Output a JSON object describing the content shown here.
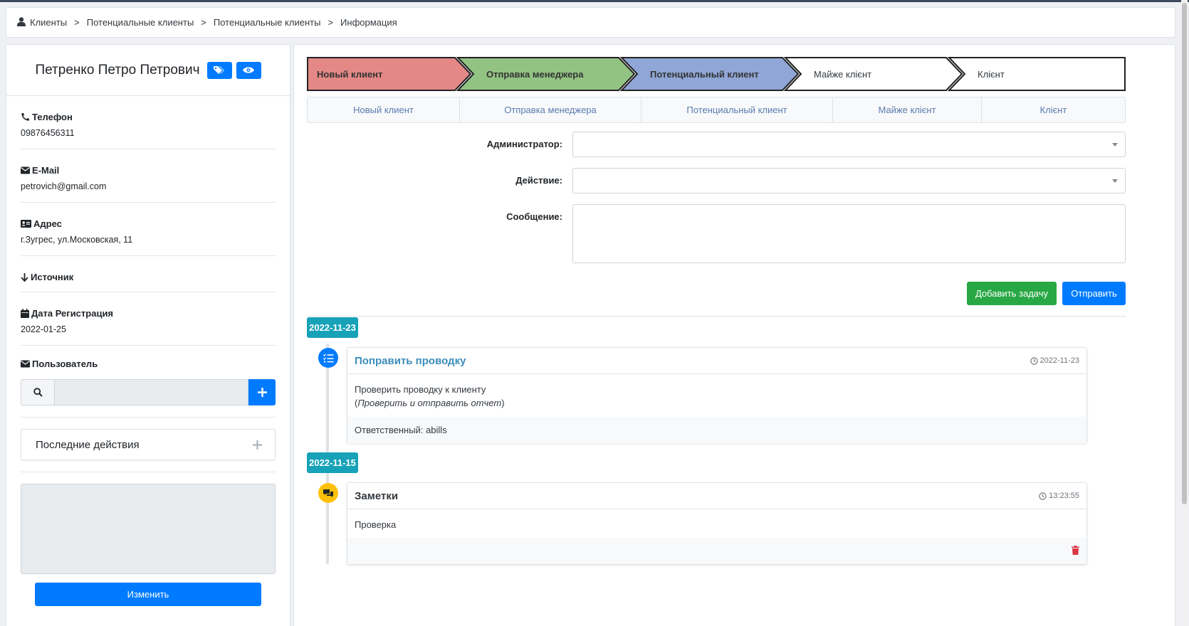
{
  "breadcrumb": [
    "Клиенты",
    "Потенциальные клиенты",
    "Потенциальные клиенты",
    "Информация"
  ],
  "breadcrumb_sep": ">",
  "client": {
    "name": "Петренко Петро Петрович",
    "phone_label": "Телефон",
    "phone": "09876456311",
    "email_label": "E-Mail",
    "email": "petrovich@gmail.com",
    "address_label": "Адрес",
    "address": "г.Зугрес, ул.Московская, 11",
    "source_label": "Источник",
    "regdate_label": "Дата Регистрация",
    "regdate": "2022-01-25",
    "user_label": "Пользователь"
  },
  "recent_actions": "Последние действия",
  "edit_button": "Изменить",
  "pipeline": [
    {
      "label": "Новый клиент",
      "color": "#e48886",
      "bold": true
    },
    {
      "label": "Отправка менеджера",
      "color": "#92c383",
      "bold": true
    },
    {
      "label": "Потенциальный клиент",
      "color": "#8fa6d6",
      "bold": true
    },
    {
      "label": "Майже клієнт",
      "color": "#ffffff",
      "bold": false
    },
    {
      "label": "Клієнт",
      "color": "#ffffff",
      "bold": false
    }
  ],
  "tabs": [
    "Новый клиент",
    "Отправка менеджера",
    "Потенциальный клиент",
    "Майже клієнт",
    "Клієнт"
  ],
  "form": {
    "admin_label": "Администратор:",
    "action_label": "Действие:",
    "message_label": "Сообщение:",
    "add_task": "Добавить задачу",
    "send": "Отправить"
  },
  "timeline": [
    {
      "date": "2022-11-23",
      "icon": "tasks-icon",
      "icon_color": "#007bff",
      "title": "Поправить проводку",
      "title_color": "#3c8dbc",
      "time": "2022-11-23",
      "body_line1": "Проверить проводку к клиенту",
      "body_line2_open": "(",
      "body_line2_italic": "Проверить и отправить отчет",
      "body_line2_close": ")",
      "footer": "Ответственный: abills"
    },
    {
      "date": "2022-11-15",
      "icon": "comments-icon",
      "icon_color": "#ffc107",
      "title": "Заметки",
      "title_color": "#343a40",
      "time": "13:23:55",
      "body_line1": "Проверка",
      "footer_icon": "trash-icon",
      "footer_icon_color": "#dc3545"
    }
  ],
  "colors": {
    "primary": "#007bff",
    "success": "#28a745",
    "info": "#17a2b8",
    "danger": "#dc3545"
  }
}
